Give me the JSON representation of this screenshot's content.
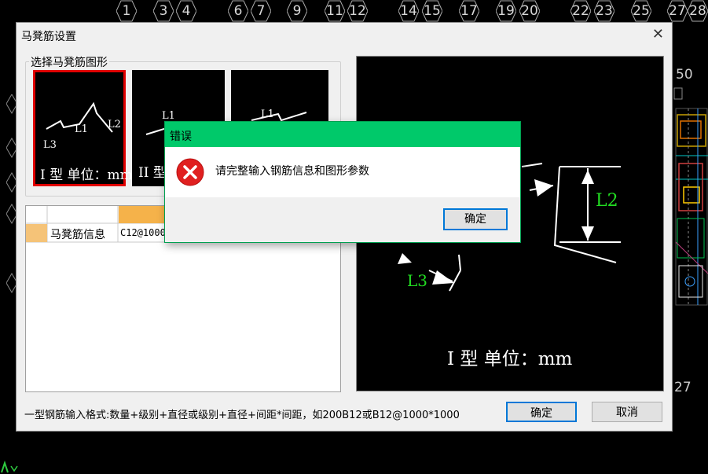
{
  "axis": {
    "numbers": [
      "1",
      "3",
      "4",
      "6",
      "7",
      "9",
      "11",
      "12",
      "14",
      "15",
      "17",
      "19",
      "20",
      "22",
      "23",
      "25",
      "27",
      "28"
    ]
  },
  "cad_side": {
    "top_label": "50",
    "bottom_label": "27"
  },
  "dialog": {
    "title": "马凳筋设置",
    "group_label": "选择马凳筋图形",
    "shapes": [
      {
        "label": "I 型 单位：mm",
        "l1": "L1",
        "l2": "L2",
        "l3": "L3"
      },
      {
        "label": "II 型",
        "l1": "L1"
      },
      {
        "label": "",
        "l1": "L1"
      }
    ],
    "table": {
      "row_header": "马凳筋信息",
      "row_value": "C12@1000"
    },
    "preview": {
      "l2": "L2",
      "l3": "L3",
      "caption": "I 型  单位：mm"
    },
    "format_note": "一型钢筋输入格式:数量+级别+直径或级别+直径+间距*间距，如200B12或B12@1000*1000",
    "ok_label": "确定",
    "cancel_label": "取消"
  },
  "error": {
    "title": "错误",
    "message": "请完整输入钢筋信息和图形参数",
    "ok_label": "确定"
  }
}
